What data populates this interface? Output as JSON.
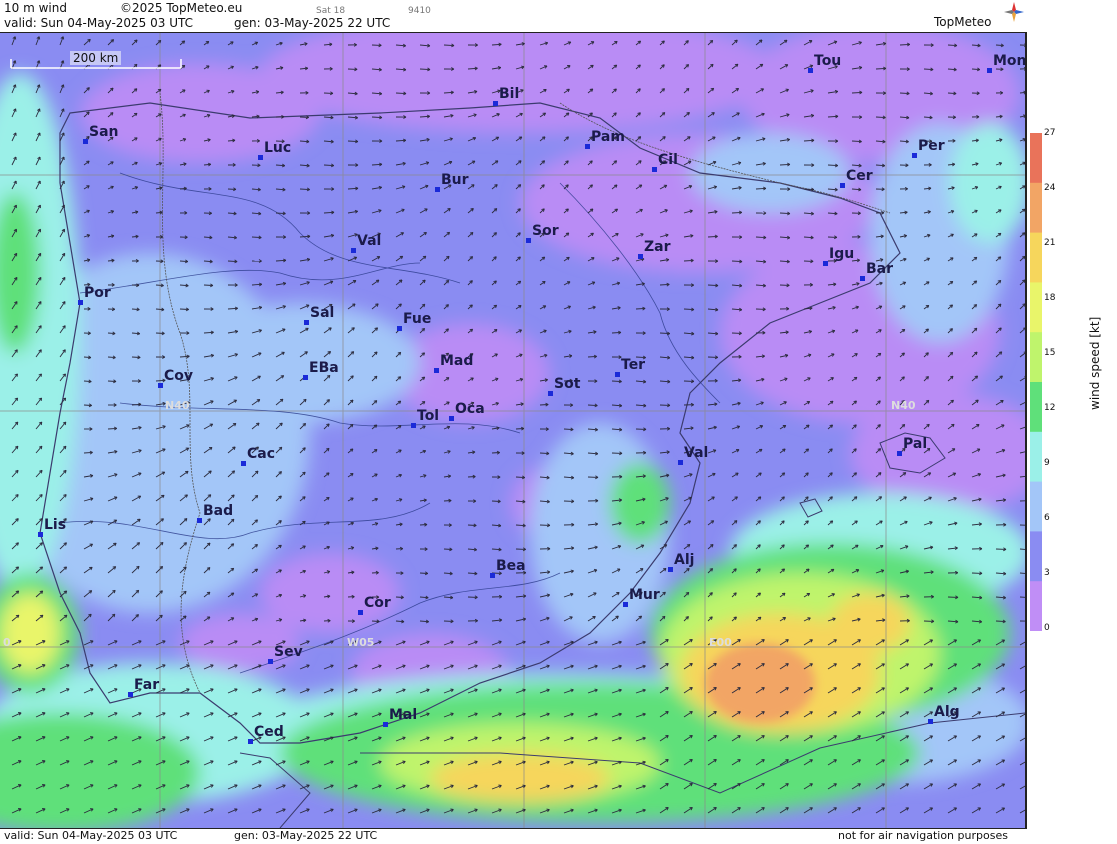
{
  "header": {
    "title": "10 m wind",
    "copyright": "©2025 TopMeteo.eu",
    "day_code": "Sat 18",
    "code": "9410",
    "valid": "valid:  Sun  04-May-2025  03 UTC",
    "gen": "gen: 03-May-2025 22 UTC",
    "brand": "TopMeteo"
  },
  "footer": {
    "valid": "valid:  Sun  04-May-2025  03 UTC",
    "gen": "gen: 03-May-2025 22 UTC",
    "notice": "not for air navigation purposes"
  },
  "scale_bar": {
    "label": "200 km"
  },
  "legend": {
    "unit": "wind speed  [kt]",
    "ticks": [
      "27",
      "24",
      "21",
      "18",
      "15",
      "12",
      "9",
      "6",
      "3",
      "0"
    ],
    "colors": [
      "#e9735a",
      "#f2a565",
      "#f6d65c",
      "#e9f56a",
      "#bff46c",
      "#5fe07a",
      "#9bf0e8",
      "#a3c6f8",
      "#8a8cf2",
      "#c08ef6"
    ]
  },
  "grid_labels": [
    "N40",
    "N40",
    "W05",
    "E00",
    "0"
  ],
  "cities": [
    {
      "name": "Tou"
    },
    {
      "name": "Mon"
    },
    {
      "name": "Bil"
    },
    {
      "name": "San"
    },
    {
      "name": "Pam"
    },
    {
      "name": "Luc"
    },
    {
      "name": "Cil"
    },
    {
      "name": "Per"
    },
    {
      "name": "Bur"
    },
    {
      "name": "Cer"
    },
    {
      "name": "Sor"
    },
    {
      "name": "Val"
    },
    {
      "name": "Zar"
    },
    {
      "name": "Igu"
    },
    {
      "name": "Bar"
    },
    {
      "name": "Por"
    },
    {
      "name": "Sal"
    },
    {
      "name": "Fue"
    },
    {
      "name": "Mad"
    },
    {
      "name": "Ter"
    },
    {
      "name": "Cov"
    },
    {
      "name": "EBa"
    },
    {
      "name": "Sot"
    },
    {
      "name": "Tol"
    },
    {
      "name": "Oca"
    },
    {
      "name": "Pal"
    },
    {
      "name": "Cac"
    },
    {
      "name": "Val"
    },
    {
      "name": "Bad"
    },
    {
      "name": "Lis"
    },
    {
      "name": "Alj"
    },
    {
      "name": "Bea"
    },
    {
      "name": "Mur"
    },
    {
      "name": "Cor"
    },
    {
      "name": "Sev"
    },
    {
      "name": "Far"
    },
    {
      "name": "Mal"
    },
    {
      "name": "Alg"
    },
    {
      "name": "Ced"
    }
  ]
}
